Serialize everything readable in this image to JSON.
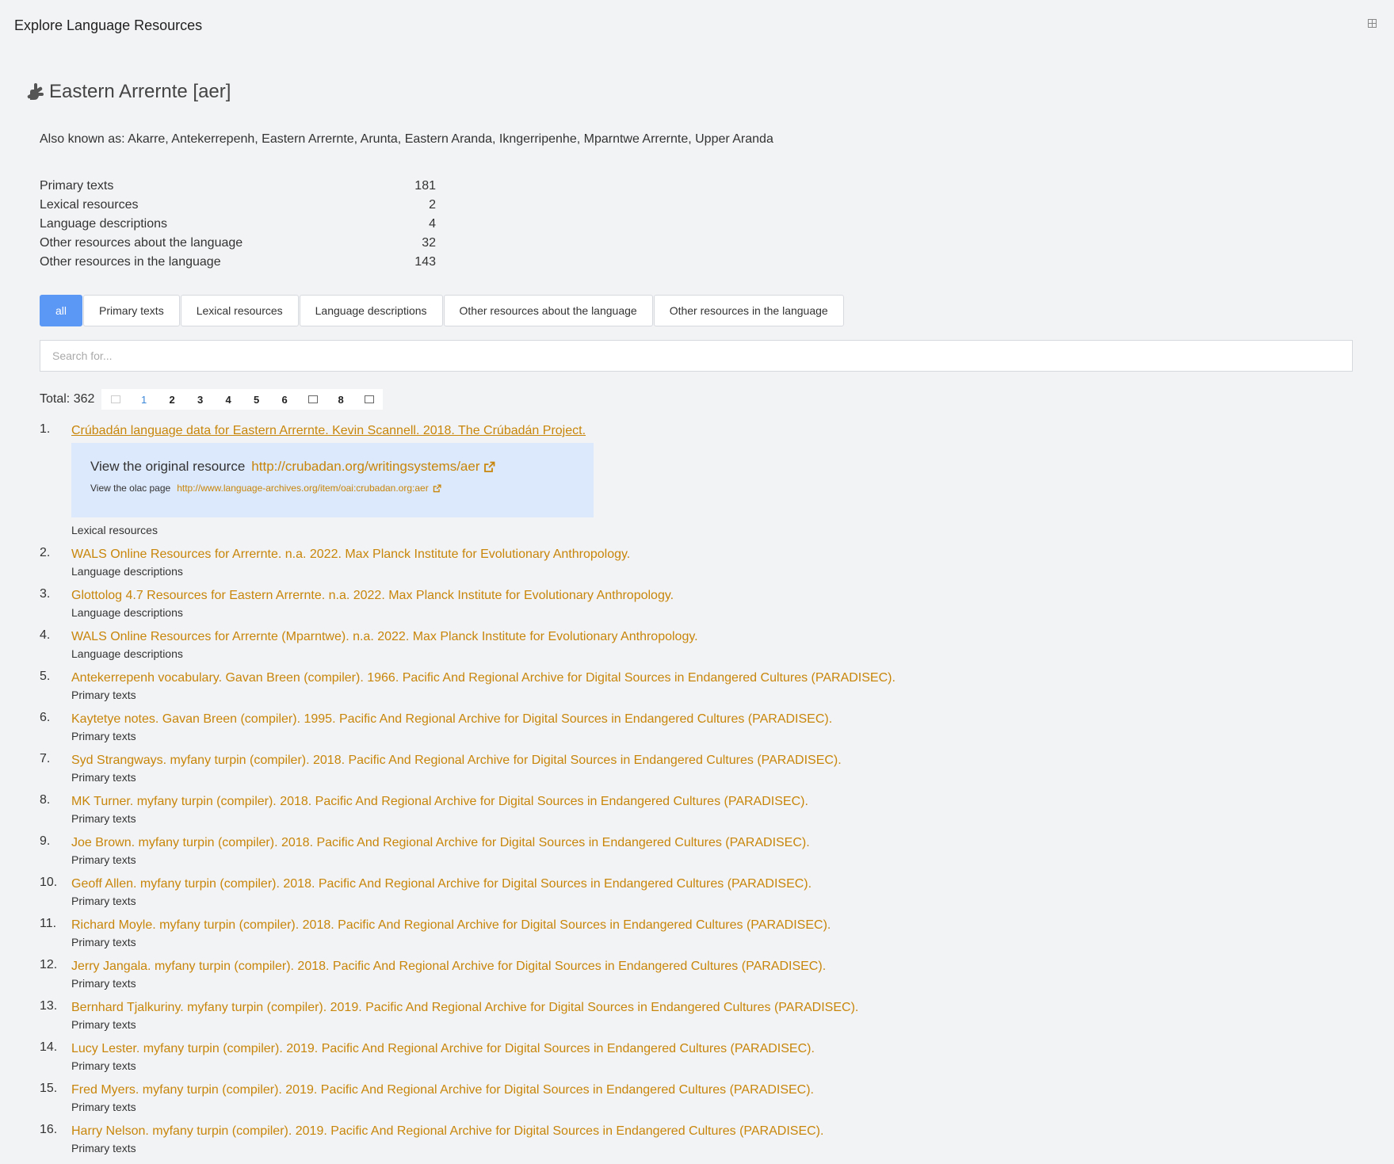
{
  "window": {
    "title": "Explore Language Resources"
  },
  "language": {
    "name": "Eastern Arrernte [aer]",
    "also_known_as": "Also known as: Akarre, Antekerrepenh, Eastern Arrernte, Arunta, Eastern Aranda, Ikngerripenhe, Mparntwe Arrernte, Upper Aranda"
  },
  "stats": [
    {
      "label": "Primary texts",
      "value": "181"
    },
    {
      "label": "Lexical resources",
      "value": "2"
    },
    {
      "label": "Language descriptions",
      "value": "4"
    },
    {
      "label": "Other resources about the language",
      "value": "32"
    },
    {
      "label": "Other resources in the language",
      "value": "143"
    }
  ],
  "tabs": [
    {
      "label": "all",
      "active": true
    },
    {
      "label": "Primary texts"
    },
    {
      "label": "Lexical resources"
    },
    {
      "label": "Language descriptions"
    },
    {
      "label": "Other resources about the language"
    },
    {
      "label": "Other resources in the language"
    }
  ],
  "search": {
    "placeholder": "Search for..."
  },
  "pagination": {
    "total": "Total: 362",
    "pages": [
      "1",
      "2",
      "3",
      "4",
      "5",
      "6",
      "8"
    ],
    "current": "1"
  },
  "detail": {
    "original_label": "View the original resource",
    "original_url": "http://crubadan.org/writingsystems/aer",
    "olac_label": "View the olac page",
    "olac_url": "http://www.language-archives.org/item/oai:crubadan.org:aer"
  },
  "results": [
    {
      "num": "1.",
      "title": "Crúbadán language data for Eastern Arrernte. Kevin Scannell. 2018. The Crúbadán Project.",
      "category": "Lexical resources"
    },
    {
      "num": "2.",
      "title": "WALS Online Resources for Arrernte. n.a. 2022. Max Planck Institute for Evolutionary Anthropology.",
      "category": "Language descriptions"
    },
    {
      "num": "3.",
      "title": "Glottolog 4.7 Resources for Eastern Arrernte. n.a. 2022. Max Planck Institute for Evolutionary Anthropology.",
      "category": "Language descriptions"
    },
    {
      "num": "4.",
      "title": "WALS Online Resources for Arrernte (Mparntwe). n.a. 2022. Max Planck Institute for Evolutionary Anthropology.",
      "category": "Language descriptions"
    },
    {
      "num": "5.",
      "title": "Antekerrepenh vocabulary. Gavan Breen (compiler). 1966. Pacific And Regional Archive for Digital Sources in Endangered Cultures (PARADISEC).",
      "category": "Primary texts"
    },
    {
      "num": "6.",
      "title": "Kaytetye notes. Gavan Breen (compiler). 1995. Pacific And Regional Archive for Digital Sources in Endangered Cultures (PARADISEC).",
      "category": "Primary texts"
    },
    {
      "num": "7.",
      "title": "Syd Strangways. myfany turpin (compiler). 2018. Pacific And Regional Archive for Digital Sources in Endangered Cultures (PARADISEC).",
      "category": "Primary texts"
    },
    {
      "num": "8.",
      "title": "MK Turner. myfany turpin (compiler). 2018. Pacific And Regional Archive for Digital Sources in Endangered Cultures (PARADISEC).",
      "category": "Primary texts"
    },
    {
      "num": "9.",
      "title": "Joe Brown. myfany turpin (compiler). 2018. Pacific And Regional Archive for Digital Sources in Endangered Cultures (PARADISEC).",
      "category": "Primary texts"
    },
    {
      "num": "10.",
      "title": "Geoff Allen. myfany turpin (compiler). 2018. Pacific And Regional Archive for Digital Sources in Endangered Cultures (PARADISEC).",
      "category": "Primary texts"
    },
    {
      "num": "11.",
      "title": "Richard Moyle. myfany turpin (compiler). 2018. Pacific And Regional Archive for Digital Sources in Endangered Cultures (PARADISEC).",
      "category": "Primary texts"
    },
    {
      "num": "12.",
      "title": "Jerry Jangala. myfany turpin (compiler). 2018. Pacific And Regional Archive for Digital Sources in Endangered Cultures (PARADISEC).",
      "category": "Primary texts"
    },
    {
      "num": "13.",
      "title": "Bernhard Tjalkuriny. myfany turpin (compiler). 2019. Pacific And Regional Archive for Digital Sources in Endangered Cultures (PARADISEC).",
      "category": "Primary texts"
    },
    {
      "num": "14.",
      "title": "Lucy Lester. myfany turpin (compiler). 2019. Pacific And Regional Archive for Digital Sources in Endangered Cultures (PARADISEC).",
      "category": "Primary texts"
    },
    {
      "num": "15.",
      "title": "Fred Myers. myfany turpin (compiler). 2019. Pacific And Regional Archive for Digital Sources in Endangered Cultures (PARADISEC).",
      "category": "Primary texts"
    },
    {
      "num": "16.",
      "title": "Harry Nelson. myfany turpin (compiler). 2019. Pacific And Regional Archive for Digital Sources in Endangered Cultures (PARADISEC).",
      "category": "Primary texts"
    }
  ]
}
